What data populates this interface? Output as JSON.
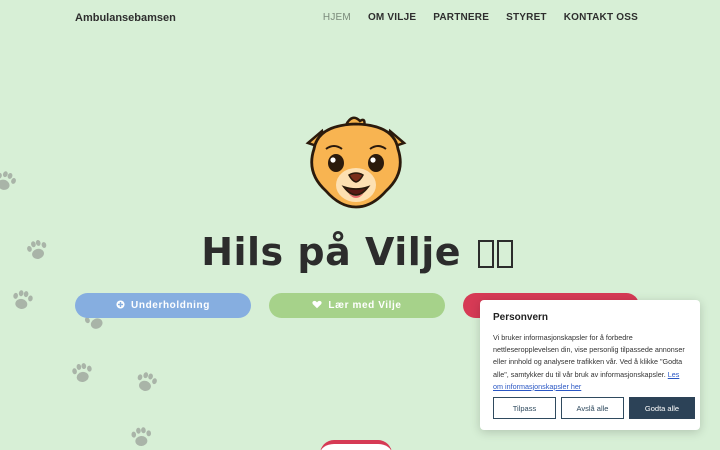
{
  "header": {
    "brand": "Ambulansebamsen",
    "nav": [
      "HJEM",
      "OM VILJE",
      "PARTNERE",
      "STYRET",
      "KONTAKT OSS"
    ]
  },
  "hero": {
    "title": "Hils på Vilje"
  },
  "buttons": {
    "entertainment": "Underholdning",
    "learn": "Lær med Vilje"
  },
  "cookie": {
    "title": "Personvern",
    "text": "Vi bruker informasjonskapsler for å forbedre nettleseropplevelsen din, vise personlig tilpassede annonser eller innhold og analysere trafikken vår. Ved å klikke \"Godta alle\", samtykker du til vår bruk av informasjonskapsler.",
    "link": "Les om informasjonskapsler her",
    "customize": "Tilpass",
    "reject": "Avslå alle",
    "accept": "Godta alle"
  },
  "colors": {
    "background": "#d7efd6",
    "blue_button": "#86aee0",
    "green_button": "#a6d28a",
    "red_button": "#d63a55",
    "accept_button": "#2c4257"
  },
  "icons": [
    "paw-print-icon",
    "circle-plus-icon",
    "heart-icon"
  ]
}
